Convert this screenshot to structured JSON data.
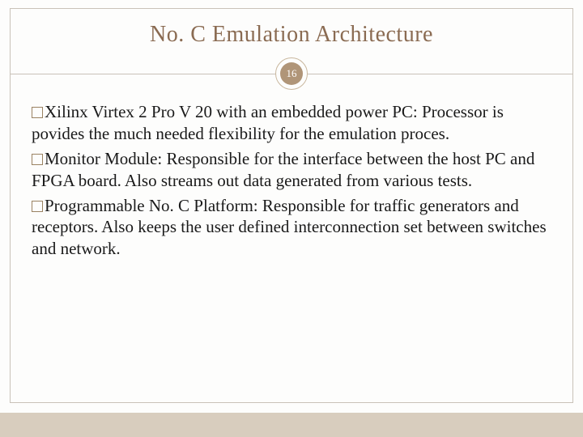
{
  "slide": {
    "title": "No. C Emulation Architecture",
    "page_number": "16",
    "bullets": [
      {
        "lead": "Xilinx Virtex 2 Pro V 20 with an embedded power PC:",
        "body": "Processor is povides the much needed flexibility for the emulation proces."
      },
      {
        "lead": "Monitor Module:",
        "body": "Responsible for the interface between the host PC and FPGA board. Also streams out data generated from various tests."
      },
      {
        "lead": "Programmable No. C Platform:",
        "body": "Responsible for traffic generators and receptors. Also keeps the user defined interconnection set between switches and network."
      }
    ]
  },
  "colors": {
    "title": "#8a6b52",
    "frame": "#c9c2b8",
    "badge_ring": "#c9b79e",
    "badge_fill": "#b09578",
    "bullet_border": "#9a8262",
    "bottom_accent": "#d8cdbe"
  }
}
